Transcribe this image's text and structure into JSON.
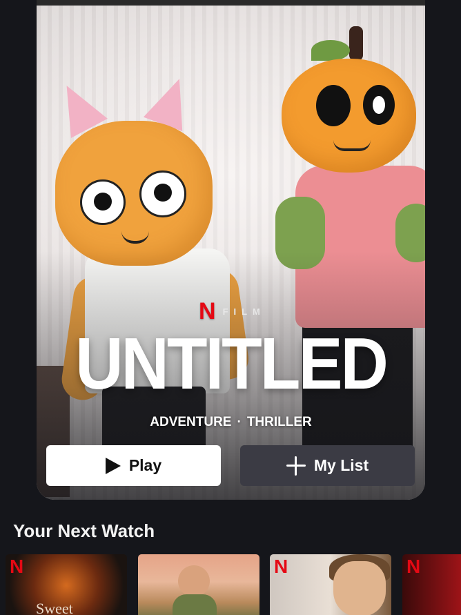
{
  "hero": {
    "brand_letter": "N",
    "type_label": "FILM",
    "title": "UNTITLED",
    "genre_1": "ADVENTURE",
    "separator": "·",
    "genre_2": "THRILLER",
    "play_label": "Play",
    "mylist_label": "My List"
  },
  "section": {
    "title": "Your Next Watch",
    "items": [
      {
        "brand_letter": "N",
        "caption": "Sweet"
      },
      {
        "brand_letter": ""
      },
      {
        "brand_letter": "N"
      },
      {
        "brand_letter": "N"
      }
    ]
  },
  "colors": {
    "background": "#15161b",
    "netflix_red": "#e50914",
    "play_button": "#ffffff",
    "mylist_button": "#3b3b44"
  },
  "icons": [
    "play-icon",
    "plus-icon",
    "netflix-logo-icon"
  ]
}
